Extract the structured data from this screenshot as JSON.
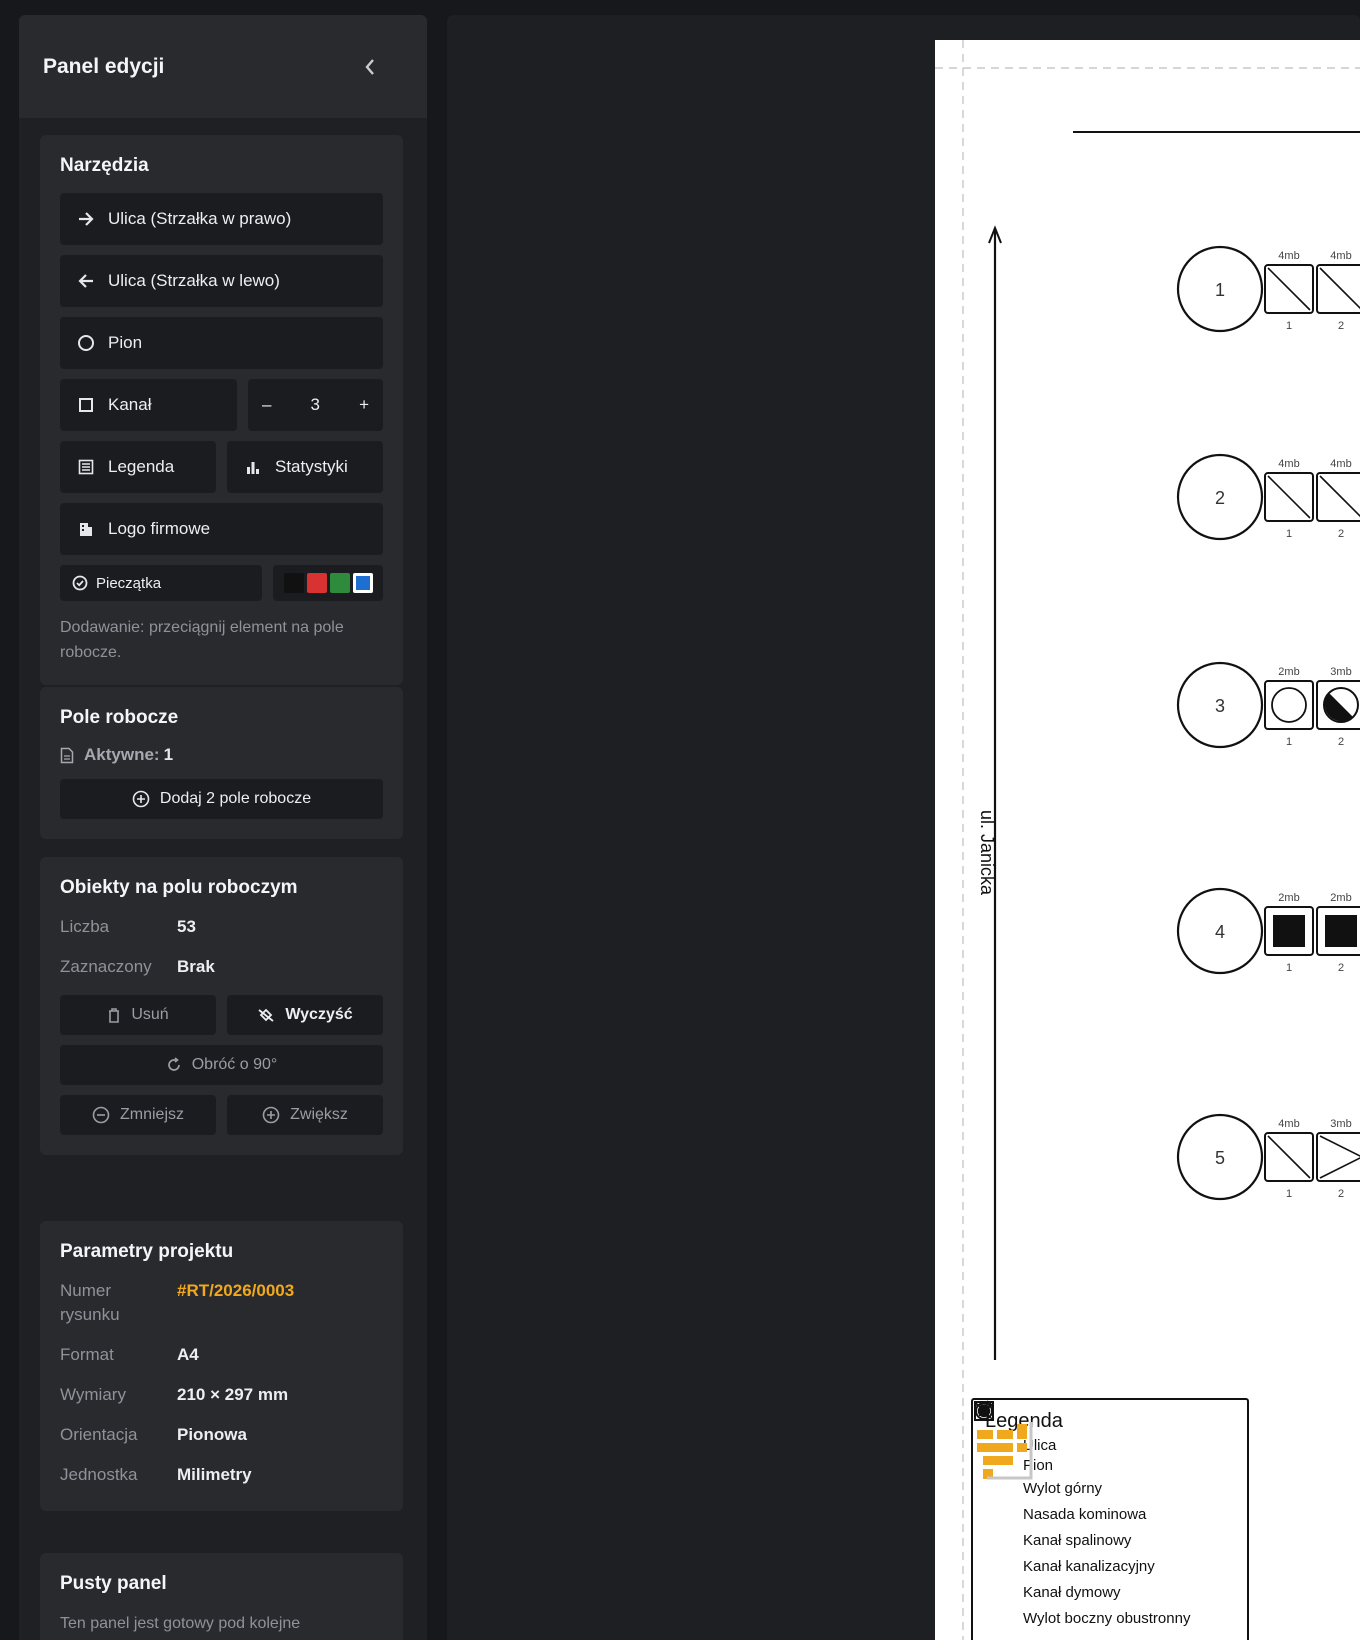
{
  "sidebar": {
    "title": "Panel edycji",
    "tools": {
      "title": "Narzędzia",
      "street_right": "Ulica (Strzałka w prawo)",
      "street_left": "Ulica (Strzałka w lewo)",
      "pion": "Pion",
      "kanal": "Kanał",
      "kanal_count": "3",
      "stepper_minus": "–",
      "stepper_plus": "+",
      "legenda": "Legenda",
      "statystyki": "Statystyki",
      "logo": "Logo firmowe",
      "stamp": "Pieczątka",
      "colors": [
        "#111111",
        "#d83232",
        "#2e8b3c",
        "#1f6fd0"
      ],
      "selected_color": "#1f6fd0",
      "hint": "Dodawanie: przeciągnij element na pole robocze."
    },
    "workspace": {
      "title": "Pole robocze",
      "active_label": "Aktywne:",
      "active_value": "1",
      "add_button": "Dodaj 2 pole robocze"
    },
    "objects": {
      "title": "Obiekty na polu roboczym",
      "count_label": "Liczba",
      "count_value": "53",
      "selected_label": "Zaznaczony",
      "selected_value": "Brak",
      "delete": "Usuń",
      "clear": "Wyczyść",
      "rotate": "Obróć o 90°",
      "shrink": "Zmniejsz",
      "enlarge": "Zwiększ"
    },
    "project": {
      "title": "Parametry projektu",
      "number_label": "Numer rysunku",
      "number_value": "#RT/2026/0003",
      "format_label": "Format",
      "format_value": "A4",
      "dims_label": "Wymiary",
      "dims_value": "210 × 297 mm",
      "orient_label": "Orientacja",
      "orient_value": "Pionowa",
      "unit_label": "Jednostka",
      "unit_value": "Milimetry"
    },
    "empty": {
      "title": "Pusty panel",
      "text": "Ten panel jest gotowy pod kolejne"
    }
  },
  "drawing": {
    "street": "ul. Janicka",
    "piony": [
      {
        "label": "1",
        "channels": [
          {
            "len": "4mb",
            "type": "boczny",
            "num": "1"
          },
          {
            "len": "4mb",
            "type": "boczny",
            "num": "2"
          }
        ]
      },
      {
        "label": "2",
        "channels": [
          {
            "len": "4mb",
            "type": "boczny",
            "num": "1"
          },
          {
            "len": "4mb",
            "type": "boczny",
            "num": "2"
          }
        ]
      },
      {
        "label": "3",
        "channels": [
          {
            "len": "2mb",
            "type": "nasada",
            "num": "1"
          },
          {
            "len": "3mb",
            "type": "kanalizacyjny",
            "num": "2"
          }
        ]
      },
      {
        "label": "4",
        "channels": [
          {
            "len": "2mb",
            "type": "dymowy",
            "num": "1"
          },
          {
            "len": "2mb",
            "type": "dymowy",
            "num": "2"
          }
        ]
      },
      {
        "label": "5",
        "channels": [
          {
            "len": "4mb",
            "type": "boczny",
            "num": "1"
          },
          {
            "len": "3mb",
            "type": "boczny2",
            "num": "2"
          }
        ]
      }
    ],
    "legend": {
      "title": "Legenda",
      "items": [
        "Ulica",
        "Pion",
        "Wylot górny",
        "Nasada kominowa",
        "Kanał spalinowy",
        "Kanał kanalizacyjny",
        "Kanał dymowy",
        "Wylot boczny obustronny"
      ]
    }
  }
}
